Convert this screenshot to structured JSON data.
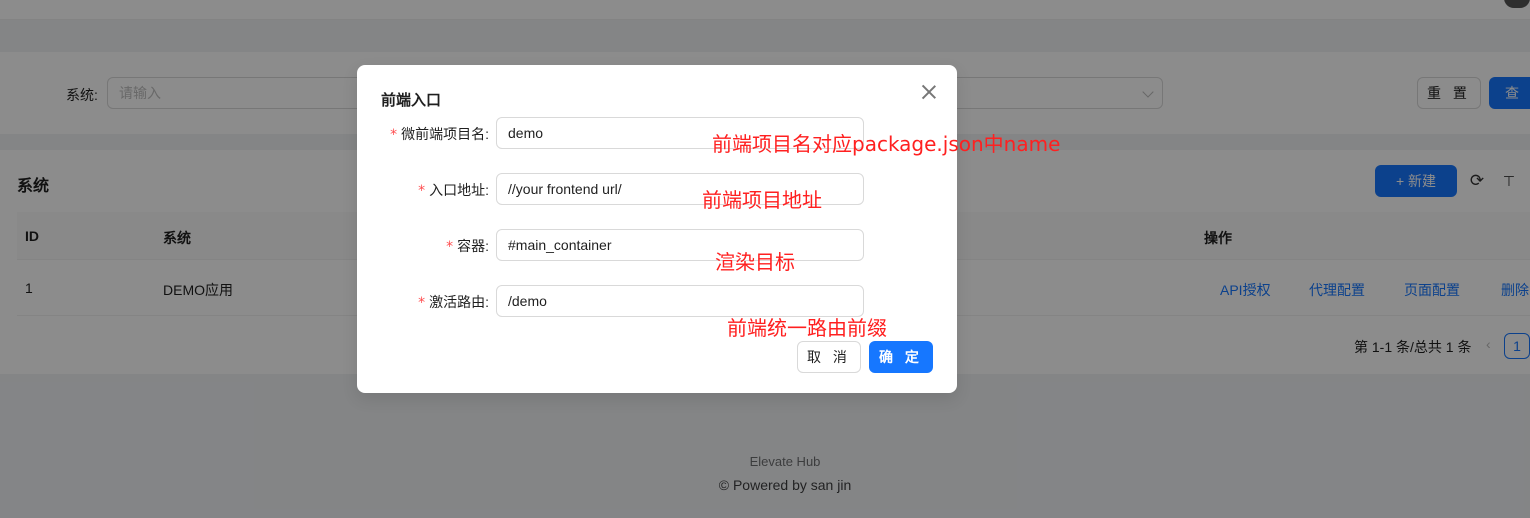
{
  "search": {
    "label": "系统:",
    "placeholder": "请输入",
    "reset_label": "重 置",
    "query_label": "查 询"
  },
  "table": {
    "title": "系统",
    "new_label": "+ 新建",
    "columns": [
      "ID",
      "系统",
      "操作"
    ],
    "rows": [
      {
        "id": "1",
        "system": "DEMO应用",
        "actions": [
          "API授权",
          "代理配置",
          "页面配置",
          "删除"
        ]
      }
    ],
    "pagination": {
      "summary": "第 1-1 条/总共 1 条",
      "current_page": "1"
    }
  },
  "footer": {
    "brand": "Elevate Hub",
    "powered": "© Powered by san jin"
  },
  "modal": {
    "title": "前端入口",
    "fields": [
      {
        "label": "微前端项目名:",
        "value": "demo"
      },
      {
        "label": "入口地址:",
        "value": "//your frontend url/"
      },
      {
        "label": "容器:",
        "value": "#main_container"
      },
      {
        "label": "激活路由:",
        "value": "/demo"
      }
    ],
    "cancel_label": "取 消",
    "ok_label": "确 定"
  },
  "annotations": [
    "前端项目名对应package.json中name",
    "前端项目地址",
    "渲染目标",
    "前端统一路由前缀"
  ],
  "colors": {
    "primary": "#1677ff",
    "required": "#ff4d4f",
    "annotation": "#ff2020"
  }
}
